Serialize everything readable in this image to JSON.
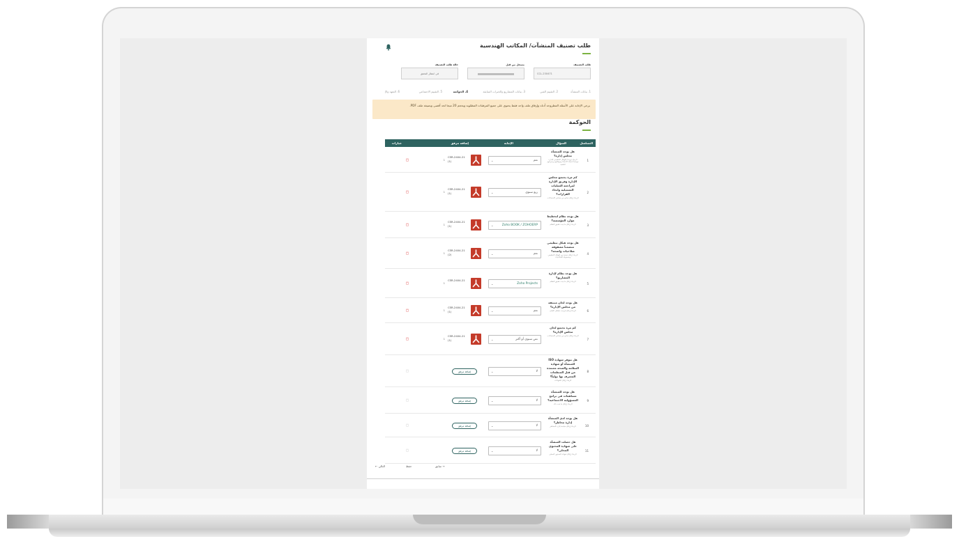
{
  "page": {
    "title": "طلب تصنيف المنشآت/ المكاتب الهندسية",
    "fields": [
      {
        "label": "طلب التصنيف",
        "value": "CCL-230471"
      },
      {
        "label": "مسجل من قبل",
        "value": ""
      },
      {
        "label": "حالة طلب التصنيف",
        "value": "في انتظار التحقق"
      }
    ],
    "tabs": [
      "1. بيانات المنشأة",
      "2. التقييم الفني",
      "3. بيانات المشاريع والخبرات السابقة",
      "4. الحوكمة",
      "5. التقييم الاجتماعي",
      "6. التعهد والإ"
    ],
    "alert": "يرجى الإجابة على الأسئلة المطروحة أدناه وإرفاق ملف واحد فقط يحتوي على جميع المرفقات المطلوبة ويحجم 20 ميجا لحد أقصى وبصيغة ملف PDF.",
    "section_title": "الحوكمة",
    "columns": [
      "التسلسل",
      "السؤال",
      "الإجابة",
      "إضافة مرفق",
      "خيارات"
    ],
    "add_label": "إضافة مرفق",
    "footer": {
      "prev": "→ سابق",
      "save": "حفظ",
      "next": "التالي ←"
    }
  },
  "rows": [
    {
      "num": "1",
      "q": "هل يوجد للمنشأة مجلس إدارة؟",
      "hint": "الرجاء تزويدنا بالهيكل التنظيمي للإدارة موضحاً أسماء الأعضاء ومؤهلاتهم وخبراتهم العلمية",
      "answer": "نعم",
      "file": "CSR-2404-21 (1)",
      "count": "1"
    },
    {
      "num": "2",
      "q": "كم مرة يجتمع مجلس الإدارة وفريق الإدارة لمراجعة العمليات التشغيلية واتخاذ القرارات؟",
      "hint": "الرجاء إرفاق نماذج من محاضر الاجتماعات",
      "answer": "ربع سنوي",
      "file": "CSR-2404-21 (1)",
      "count": "1"
    },
    {
      "num": "3",
      "q": "هل يوجد نظام لتخطيط موارد المؤسسة؟",
      "hint": "الرجاء إرفاق ما يثبت تطبيق النظام",
      "answer": "Zoho BOOK / ZOHOERP",
      "file": "CSR-2404-21 (1)",
      "count": "1"
    },
    {
      "num": "4",
      "q": "هل يوجد هيكل تنظيمي متضمناً مصفوفة صلاحيات واضحة؟",
      "hint": "الرجاء إرفاق نسخة من الهيكل التنظيمي ومصفوفة الصلاحيات",
      "answer": "نعم",
      "file": "CSR-2404-21 (2)",
      "count": "1"
    },
    {
      "num": "5",
      "q": "هل يوجد نظام لإدارة المشاريع؟",
      "hint": "الرجاء إرفاق ما يثبت تطبيق النظام",
      "answer": "Zoho Projects",
      "file": "CSR-2404-21",
      "count": "1"
    },
    {
      "num": "6",
      "q": "هل يوجد لجان منبثقة من مجلس الإدارة؟",
      "hint": "الرجاء إرفاق قرارات تشكيل اللجان",
      "answer": "نعم",
      "file": "CSR-2404-21 (1)",
      "count": "1"
    },
    {
      "num": "7",
      "q": "كم مرة تجتمع لجان مجلس الإدارة؟",
      "hint": "الرجاء إرفاق نماذج من محاضر الاجتماعات",
      "answer": "نص سنوي أو أكثر",
      "file": "CSR-2404-21 (1)",
      "count": "1"
    },
    {
      "num": "8",
      "q": "هل تتوفر شهادة ISO للمنشأة أو شهادة السلامة والصحة معتمدة من قبل المنظمات المعترف بها دولياً؟",
      "hint": "الرجاء إرفاق الشهادات",
      "answer": "لا",
      "file": "",
      "count": ""
    },
    {
      "num": "9",
      "q": "هل توجد للمنشأة مساهمات في برامج المسؤولية الاجتماعية؟",
      "hint": "الرجاء إرفاق ما يثبت ذلك",
      "answer": "لا",
      "file": "",
      "count": ""
    },
    {
      "num": "10",
      "q": "هل يوجد لدى المنشأة إدارة مخاطر؟",
      "hint": "الرجاء إرفاق سياسة إدارة المخاطر",
      "answer": "لا",
      "file": "",
      "count": ""
    },
    {
      "num": "11",
      "q": "هل حصلت المنشأة على شهادة المحتوى المحلي؟",
      "hint": "الرجاء إرفاق شهادة المحتوى المحلي",
      "answer": "لا",
      "file": "",
      "count": ""
    }
  ]
}
